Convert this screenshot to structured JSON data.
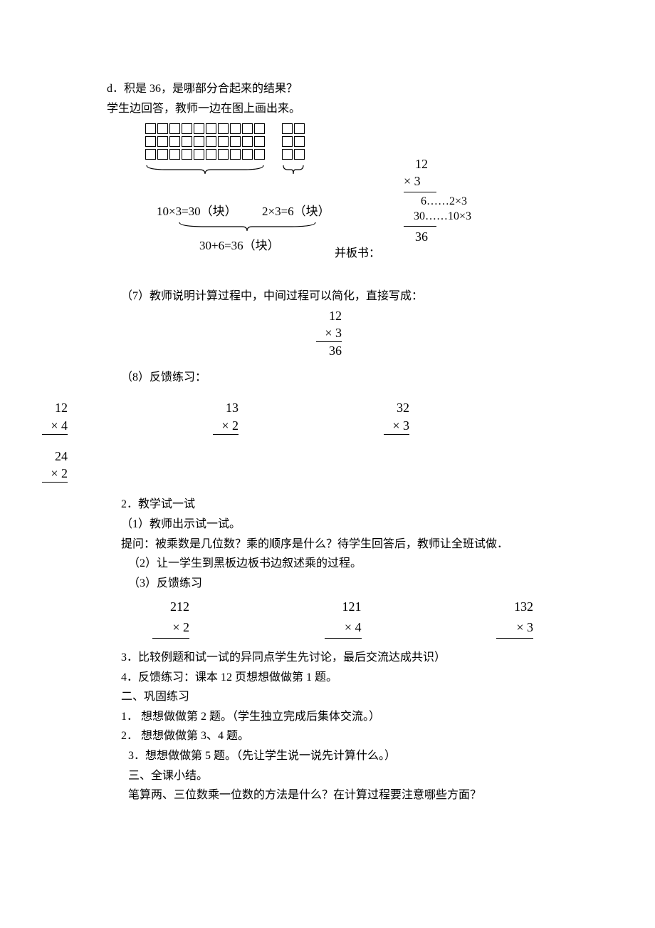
{
  "p1": "d．积是 36，是哪部分合起来的结果？",
  "p2": "学生边回答，教师一边在图上画出来。",
  "diagram": {
    "calc_left": "10×3=30（块）",
    "calc_right": "2×3=6（块）",
    "calc_bottom": "30+6=36（块）",
    "board_label": "并板书：",
    "vcalc": {
      "r1": "12",
      "r2": "×  3",
      "r3": "6……2×3",
      "r4": "30……10×3",
      "r5": "36"
    }
  },
  "p7": "（7）教师说明计算过程中，中间过程可以简化，直接写成：",
  "simplify": {
    "r1": "12",
    "r2": "×  3",
    "r3": "36"
  },
  "p8": "（8）反馈练习：",
  "practice1": [
    {
      "a": "12",
      "b": "× 4"
    },
    {
      "a": "13",
      "b": "× 2"
    },
    {
      "a": "32",
      "b": "× 3"
    }
  ],
  "practice_extra": {
    "a": "24",
    "b": "× 2"
  },
  "s2_title": "2．教学试一试",
  "s2_1": "（1）教师出示试一试。",
  "s2_q": "提问：被乘数是几位数？乘的顺序是什么？待学生回答后，教师让全班试做．",
  "s2_2": "（2）让一学生到黑板边板书边叙述乘的过程。",
  "s2_3": "（3）反馈练习",
  "practice2": [
    {
      "a": "212",
      "b": "×   2"
    },
    {
      "a": "121",
      "b": "×   4"
    },
    {
      "a": "132",
      "b": "×   3"
    }
  ],
  "p3_line": "3．比较例题和试一试的异同点学生先讨论，最后交流达成共识）",
  "p4_line": "4．反馈练习：课本 12 页想想做做第 1 题。",
  "sec2_title": "二、巩固练习",
  "sec2_1": "1． 想想做做第 2 题。（学生独立完成后集体交流。）",
  "sec2_2": "2． 想想做做第 3、4 题。",
  "sec2_3": "3．想想做做第 5 题。（先让学生说一说先计算什么。）",
  "sec3_title": "三、全课小结。",
  "sec3_q": "笔算两、三位数乘一位数的方法是什么？在计算过程要注意哪些方面？"
}
